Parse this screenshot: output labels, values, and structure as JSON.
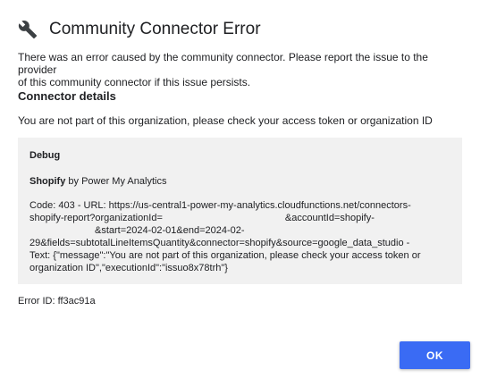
{
  "dialog": {
    "title": "Community Connector Error",
    "icon": "wrench-icon",
    "intro_line1": "There was an error caused by the community connector. Please report the issue to the provider",
    "intro_line2": "of this community connector if this issue persists.",
    "section_heading": "Connector details",
    "message": "You are not part of this organization, please check your access token or organization ID",
    "debug": {
      "title": "Debug",
      "connector_name": "Shopify",
      "connector_by": " by Power My Analytics",
      "lines": [
        {
          "a": "Code: 403 - URL: https://us-central1-power-my-analytics.cloudfunctions.net/connectors-",
          "b": ""
        },
        {
          "a": "shopify-report?organizationId=",
          "b": "&accountId=shopify-"
        },
        {
          "a": "",
          "b": "&start=2024-02-01&end=2024-02-"
        },
        {
          "a": "29&fields=subtotalLineItemsQuantity&connector=shopify&source=google_data_studio -",
          "b": ""
        },
        {
          "a": "Text: {\"message\":\"You are not part of this organization, please check your access token or",
          "b": ""
        },
        {
          "a": "organization ID\",\"executionId\":\"issuo8x78trh\"}",
          "b": ""
        }
      ]
    },
    "error_id": "Error ID: ff3ac91a",
    "ok_label": "OK"
  },
  "colors": {
    "accent": "#3a6bf4",
    "debug_background": "#f1f1f1",
    "text": "#202124"
  }
}
